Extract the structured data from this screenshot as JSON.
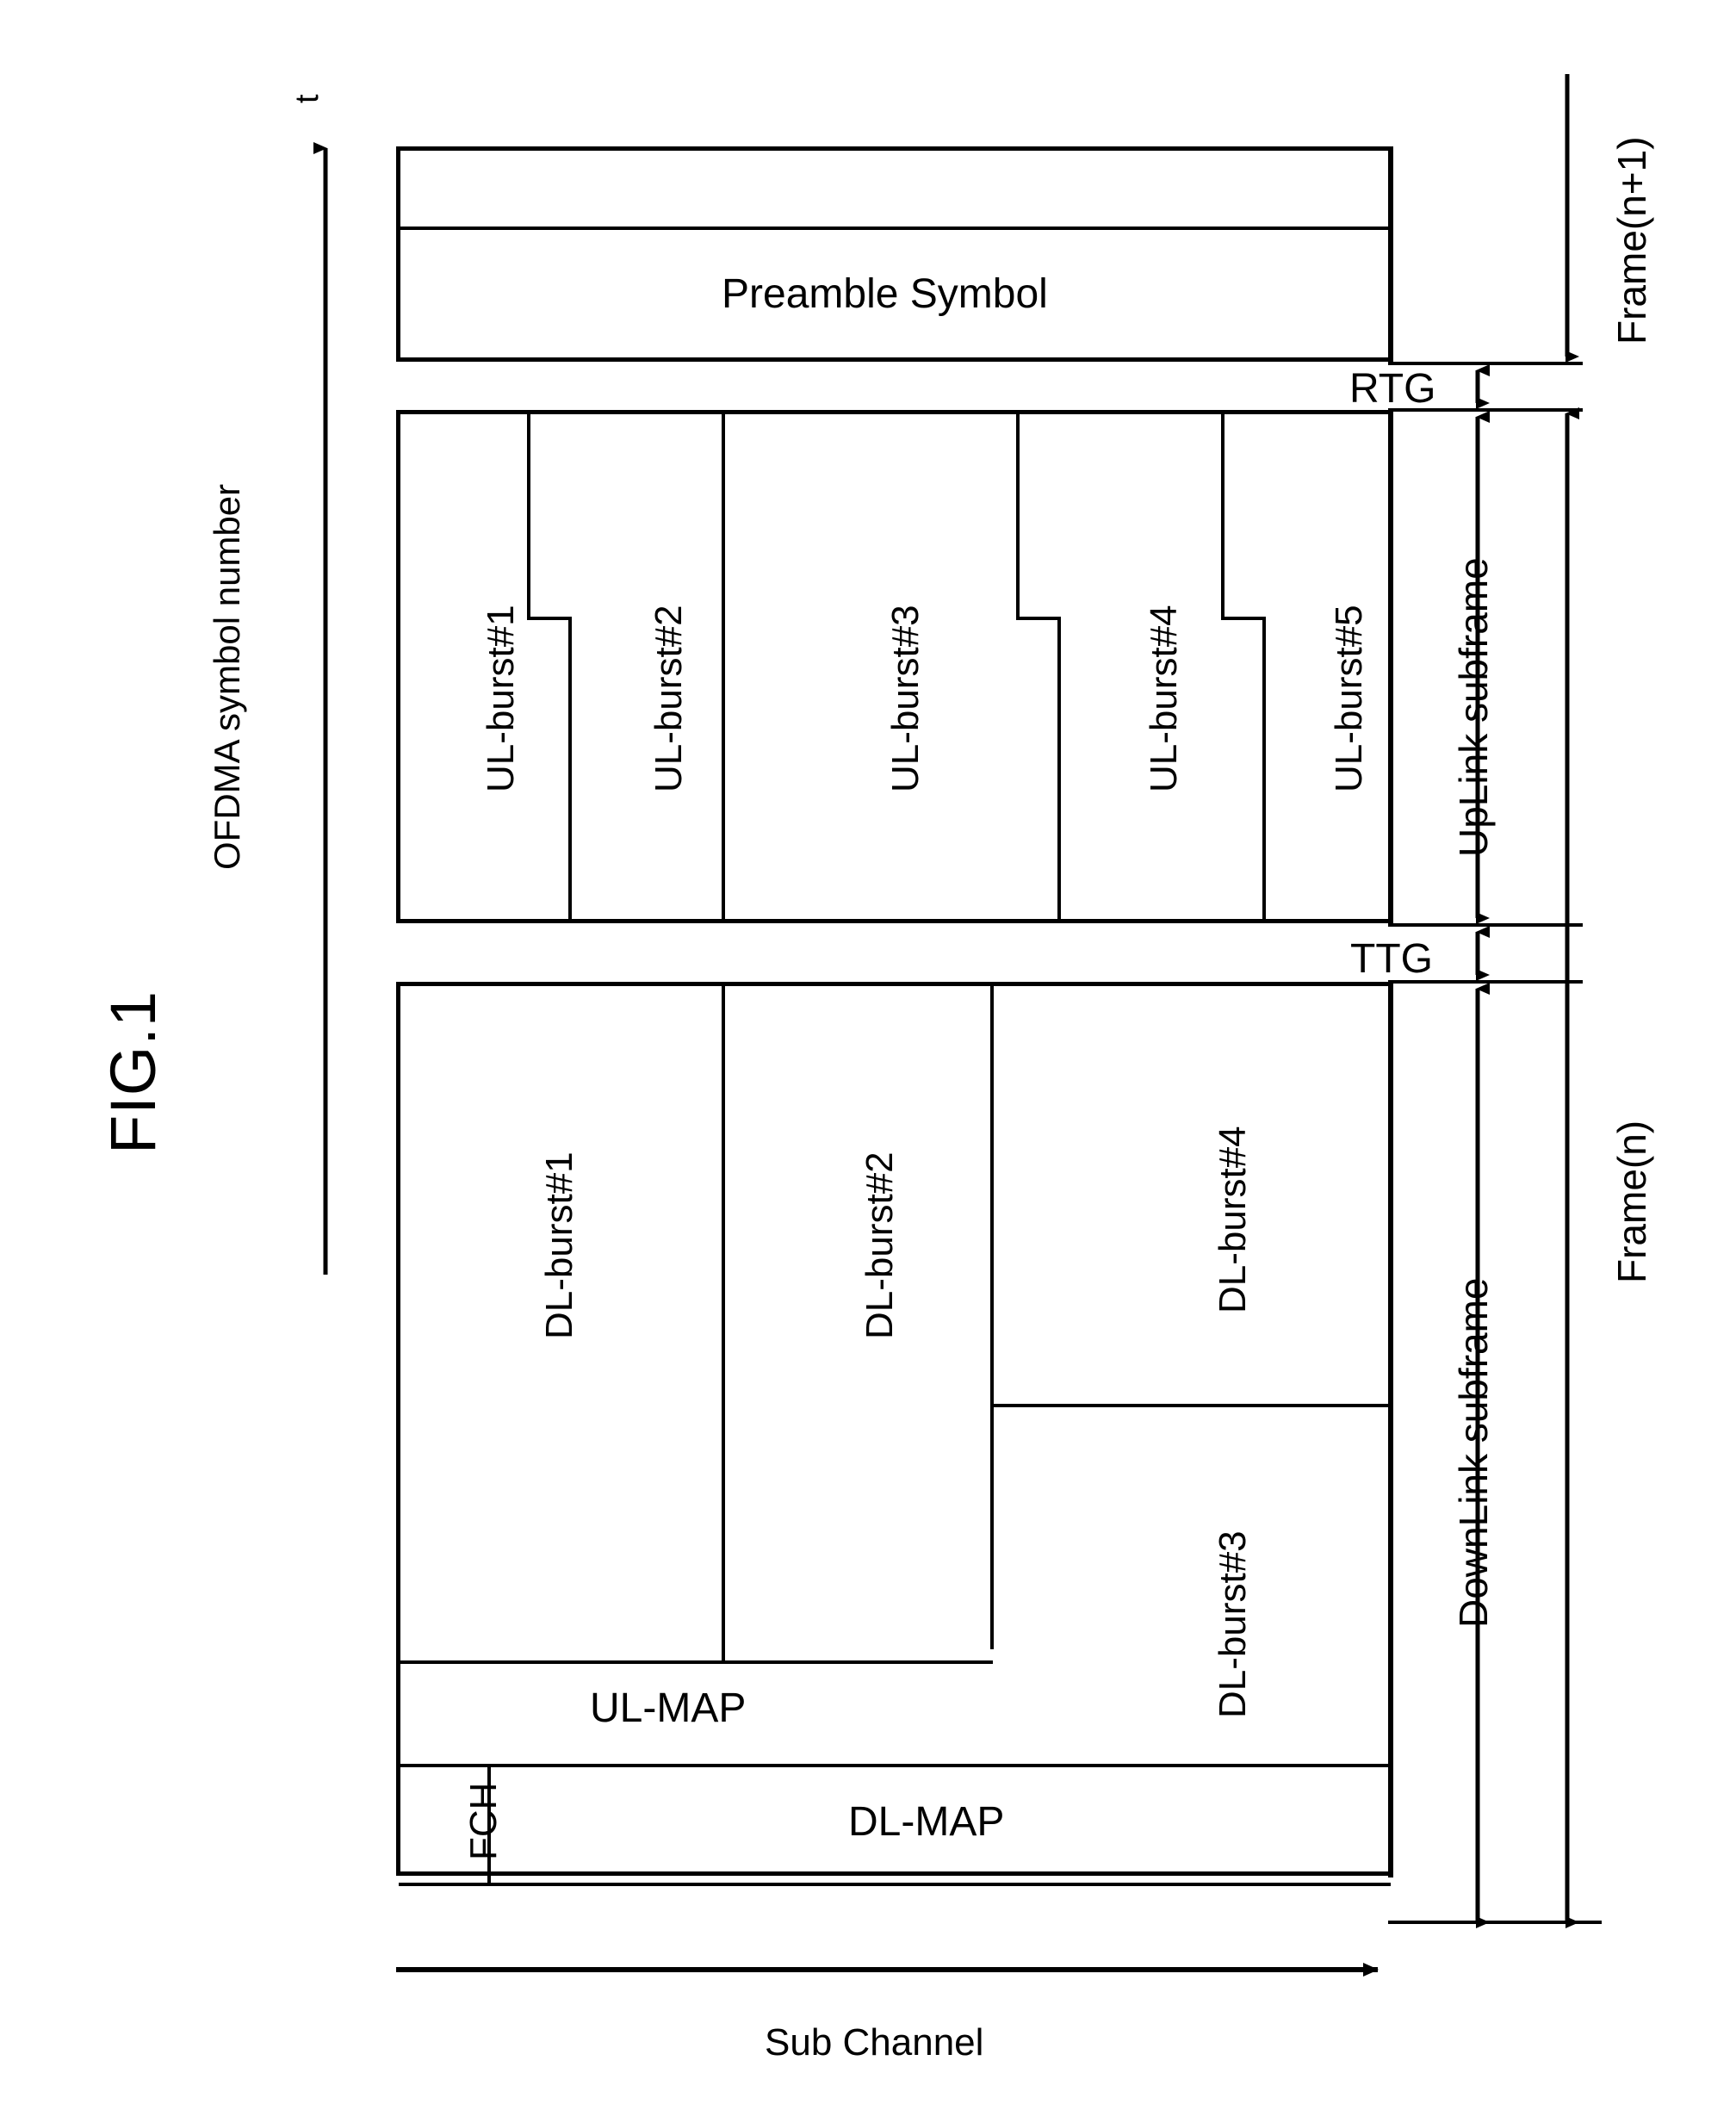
{
  "figure": {
    "title": "FIG.1",
    "y_axis_label": "OFDMA symbol number",
    "y_axis_tick": "t",
    "x_axis_label": "Sub Channel"
  },
  "preamble": {
    "label": "Preamble Symbol"
  },
  "uplink": {
    "subframe_label": "UpLink subframe",
    "bursts": [
      {
        "label": "UL-burst#1"
      },
      {
        "label": "UL-burst#2"
      },
      {
        "label": "UL-burst#3"
      },
      {
        "label": "UL-burst#4"
      },
      {
        "label": "UL-burst#5"
      }
    ]
  },
  "downlink": {
    "subframe_label": "DownLink subframe",
    "bursts": [
      {
        "label": "DL-burst#1"
      },
      {
        "label": "DL-burst#2"
      },
      {
        "label": "DL-burst#3"
      },
      {
        "label": "DL-burst#4"
      }
    ],
    "ul_map_label": "UL-MAP",
    "dl_map_label": "DL-MAP",
    "fch_label": "FCH"
  },
  "gaps": {
    "rtg": "RTG",
    "ttg": "TTG"
  },
  "frames": {
    "current": "Frame(n)",
    "next": "Frame(n+1)"
  },
  "chart_data": {
    "type": "diagram",
    "title": "FIG.1",
    "description": "WiMAX OFDMA TDD frame structure: time on vertical axis (OFDMA symbol number), sub-channel on horizontal axis",
    "xlabel": "Sub Channel",
    "ylabel": "OFDMA symbol number",
    "regions": [
      {
        "name": "DL-MAP",
        "group": "DownLink subframe"
      },
      {
        "name": "FCH",
        "group": "DownLink subframe"
      },
      {
        "name": "UL-MAP",
        "group": "DownLink subframe"
      },
      {
        "name": "DL-burst#1",
        "group": "DownLink subframe"
      },
      {
        "name": "DL-burst#2",
        "group": "DownLink subframe"
      },
      {
        "name": "DL-burst#3",
        "group": "DownLink subframe"
      },
      {
        "name": "DL-burst#4",
        "group": "DownLink subframe"
      },
      {
        "name": "TTG",
        "group": "guard"
      },
      {
        "name": "UL-burst#1",
        "group": "UpLink subframe"
      },
      {
        "name": "UL-burst#2",
        "group": "UpLink subframe"
      },
      {
        "name": "UL-burst#3",
        "group": "UpLink subframe"
      },
      {
        "name": "UL-burst#4",
        "group": "UpLink subframe"
      },
      {
        "name": "UL-burst#5",
        "group": "UpLink subframe"
      },
      {
        "name": "RTG",
        "group": "guard"
      },
      {
        "name": "Preamble Symbol",
        "group": "Frame(n+1)"
      }
    ],
    "span_markers": [
      "Frame(n)",
      "Frame(n+1)",
      "UpLink subframe",
      "DownLink subframe",
      "RTG",
      "TTG"
    ]
  }
}
